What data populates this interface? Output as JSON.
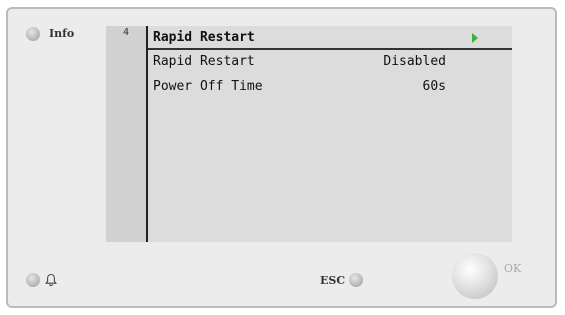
{
  "buttons": {
    "info_label": "Info",
    "esc_label": "ESC",
    "ok_label": "OK",
    "bell_icon": "bell-icon"
  },
  "screen": {
    "index": "4",
    "title": "Rapid Restart",
    "title_arrow_icon": "arrow-right-icon",
    "rows": [
      {
        "label": "Rapid Restart",
        "value": "Disabled"
      },
      {
        "label": "Power Off Time",
        "value": "60s"
      }
    ]
  },
  "colors": {
    "arrow": "#38b23a",
    "screen_bg": "#dcdcdc",
    "panel_bg": "#ececec"
  }
}
